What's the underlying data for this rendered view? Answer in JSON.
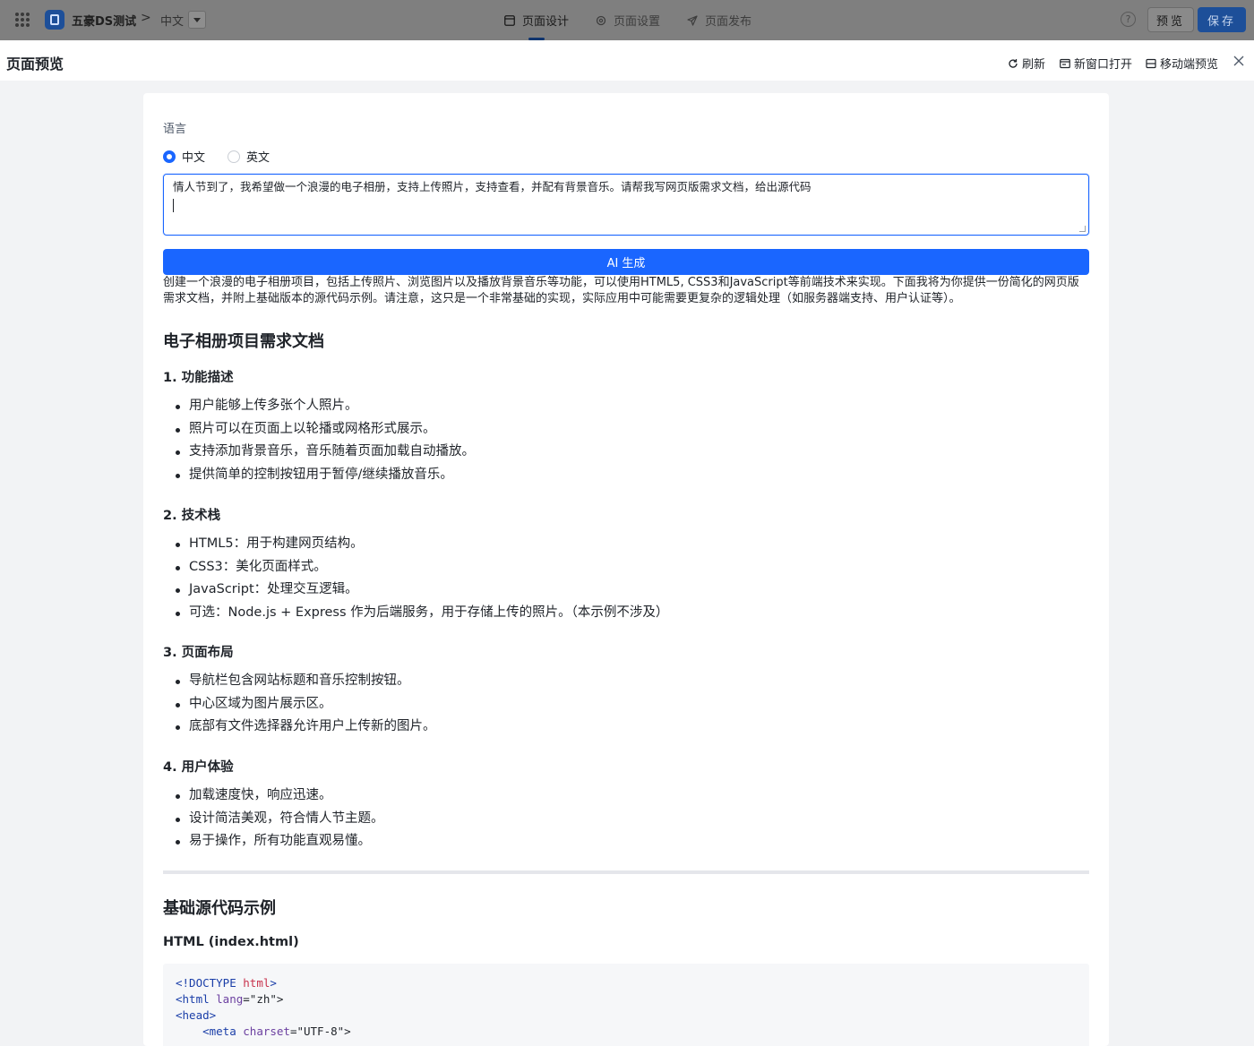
{
  "topbar": {
    "app_name": "五豪DS测试",
    "crumb_sep": ">",
    "language": "中文",
    "tabs": [
      {
        "label": "页面设计",
        "icon": "layout-icon",
        "active": true
      },
      {
        "label": "页面设置",
        "icon": "gear-icon",
        "active": false
      },
      {
        "label": "页面发布",
        "icon": "send-icon",
        "active": false
      }
    ],
    "help": "?",
    "preview_label": "预览",
    "save_label": "保存",
    "accent": "#1a66ff"
  },
  "preview_header": {
    "title": "页面预览",
    "refresh": "刷新",
    "new_window": "新窗口打开",
    "mobile_preview": "移动端预览"
  },
  "form": {
    "language_label": "语言",
    "options": [
      "中文",
      "英文"
    ],
    "selected": "中文",
    "prompt_value": "情人节到了，我希望做一个浪漫的电子相册，支持上传照片，支持查看，并配有背景音乐。请帮我写网页版需求文档，给出源代码",
    "generate_label": "AI 生成"
  },
  "result": {
    "intro": "创建一个浪漫的电子相册项目，包括上传照片、浏览图片以及播放背景音乐等功能，可以使用HTML5, CSS3和JavaScript等前端技术来实现。下面我将为你提供一份简化的网页版需求文档，并附上基础版本的源代码示例。请注意，这只是一个非常基础的实现，实际应用中可能需要更复杂的逻辑处理（如服务器端支持、用户认证等）。",
    "doc_title": "电子相册项目需求文档",
    "sections": [
      {
        "title": "1. 功能描述",
        "items": [
          "用户能够上传多张个人照片。",
          "照片可以在页面上以轮播或网格形式展示。",
          "支持添加背景音乐，音乐随着页面加载自动播放。",
          "提供简单的控制按钮用于暂停/继续播放音乐。"
        ]
      },
      {
        "title": "2. 技术栈",
        "items": [
          "HTML5：用于构建网页结构。",
          "CSS3：美化页面样式。",
          "JavaScript：处理交互逻辑。",
          "可选：Node.js + Express 作为后端服务，用于存储上传的照片。（本示例不涉及）"
        ]
      },
      {
        "title": "3. 页面布局",
        "items": [
          "导航栏包含网站标题和音乐控制按钮。",
          "中心区域为图片展示区。",
          "底部有文件选择器允许用户上传新的图片。"
        ]
      },
      {
        "title": "4. 用户体验",
        "items": [
          "加载速度快，响应迅速。",
          "设计简洁美观，符合情人节主题。",
          "易于操作，所有功能直观易懂。"
        ]
      }
    ],
    "code_title": "基础源代码示例",
    "code_subtitle": "HTML (index.html)",
    "code": {
      "l1_a": "<!DOCTYPE ",
      "l1_b": "html",
      "l1_c": ">",
      "l2_a": "<html ",
      "l2_b": "lang",
      "l2_c": "=\"zh\">",
      "l3": "<head>",
      "l4_a": "    <meta ",
      "l4_b": "charset",
      "l4_c": "=\"UTF-8\">"
    }
  }
}
